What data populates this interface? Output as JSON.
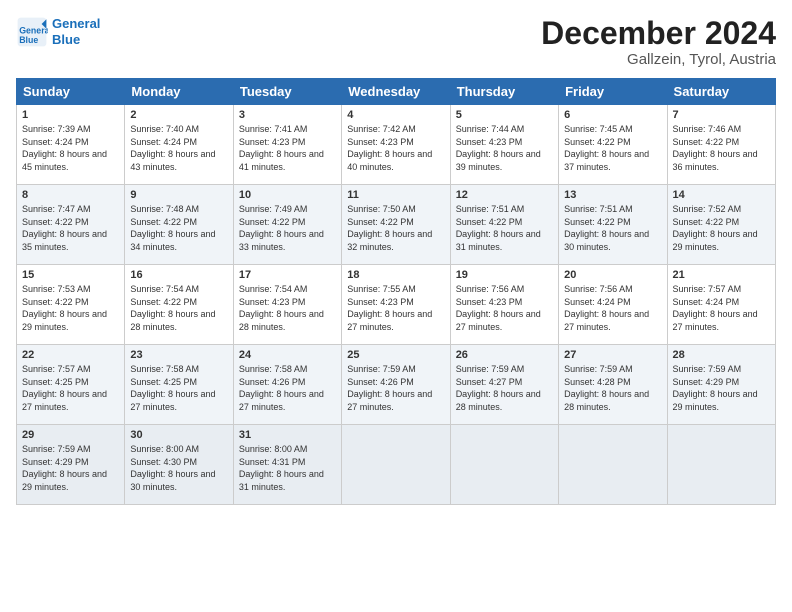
{
  "logo": {
    "line1": "General",
    "line2": "Blue"
  },
  "header": {
    "title": "December 2024",
    "location": "Gallzein, Tyrol, Austria"
  },
  "weekdays": [
    "Sunday",
    "Monday",
    "Tuesday",
    "Wednesday",
    "Thursday",
    "Friday",
    "Saturday"
  ],
  "weeks": [
    [
      {
        "day": "1",
        "sunrise": "Sunrise: 7:39 AM",
        "sunset": "Sunset: 4:24 PM",
        "daylight": "Daylight: 8 hours and 45 minutes."
      },
      {
        "day": "2",
        "sunrise": "Sunrise: 7:40 AM",
        "sunset": "Sunset: 4:24 PM",
        "daylight": "Daylight: 8 hours and 43 minutes."
      },
      {
        "day": "3",
        "sunrise": "Sunrise: 7:41 AM",
        "sunset": "Sunset: 4:23 PM",
        "daylight": "Daylight: 8 hours and 41 minutes."
      },
      {
        "day": "4",
        "sunrise": "Sunrise: 7:42 AM",
        "sunset": "Sunset: 4:23 PM",
        "daylight": "Daylight: 8 hours and 40 minutes."
      },
      {
        "day": "5",
        "sunrise": "Sunrise: 7:44 AM",
        "sunset": "Sunset: 4:23 PM",
        "daylight": "Daylight: 8 hours and 39 minutes."
      },
      {
        "day": "6",
        "sunrise": "Sunrise: 7:45 AM",
        "sunset": "Sunset: 4:22 PM",
        "daylight": "Daylight: 8 hours and 37 minutes."
      },
      {
        "day": "7",
        "sunrise": "Sunrise: 7:46 AM",
        "sunset": "Sunset: 4:22 PM",
        "daylight": "Daylight: 8 hours and 36 minutes."
      }
    ],
    [
      {
        "day": "8",
        "sunrise": "Sunrise: 7:47 AM",
        "sunset": "Sunset: 4:22 PM",
        "daylight": "Daylight: 8 hours and 35 minutes."
      },
      {
        "day": "9",
        "sunrise": "Sunrise: 7:48 AM",
        "sunset": "Sunset: 4:22 PM",
        "daylight": "Daylight: 8 hours and 34 minutes."
      },
      {
        "day": "10",
        "sunrise": "Sunrise: 7:49 AM",
        "sunset": "Sunset: 4:22 PM",
        "daylight": "Daylight: 8 hours and 33 minutes."
      },
      {
        "day": "11",
        "sunrise": "Sunrise: 7:50 AM",
        "sunset": "Sunset: 4:22 PM",
        "daylight": "Daylight: 8 hours and 32 minutes."
      },
      {
        "day": "12",
        "sunrise": "Sunrise: 7:51 AM",
        "sunset": "Sunset: 4:22 PM",
        "daylight": "Daylight: 8 hours and 31 minutes."
      },
      {
        "day": "13",
        "sunrise": "Sunrise: 7:51 AM",
        "sunset": "Sunset: 4:22 PM",
        "daylight": "Daylight: 8 hours and 30 minutes."
      },
      {
        "day": "14",
        "sunrise": "Sunrise: 7:52 AM",
        "sunset": "Sunset: 4:22 PM",
        "daylight": "Daylight: 8 hours and 29 minutes."
      }
    ],
    [
      {
        "day": "15",
        "sunrise": "Sunrise: 7:53 AM",
        "sunset": "Sunset: 4:22 PM",
        "daylight": "Daylight: 8 hours and 29 minutes."
      },
      {
        "day": "16",
        "sunrise": "Sunrise: 7:54 AM",
        "sunset": "Sunset: 4:22 PM",
        "daylight": "Daylight: 8 hours and 28 minutes."
      },
      {
        "day": "17",
        "sunrise": "Sunrise: 7:54 AM",
        "sunset": "Sunset: 4:23 PM",
        "daylight": "Daylight: 8 hours and 28 minutes."
      },
      {
        "day": "18",
        "sunrise": "Sunrise: 7:55 AM",
        "sunset": "Sunset: 4:23 PM",
        "daylight": "Daylight: 8 hours and 27 minutes."
      },
      {
        "day": "19",
        "sunrise": "Sunrise: 7:56 AM",
        "sunset": "Sunset: 4:23 PM",
        "daylight": "Daylight: 8 hours and 27 minutes."
      },
      {
        "day": "20",
        "sunrise": "Sunrise: 7:56 AM",
        "sunset": "Sunset: 4:24 PM",
        "daylight": "Daylight: 8 hours and 27 minutes."
      },
      {
        "day": "21",
        "sunrise": "Sunrise: 7:57 AM",
        "sunset": "Sunset: 4:24 PM",
        "daylight": "Daylight: 8 hours and 27 minutes."
      }
    ],
    [
      {
        "day": "22",
        "sunrise": "Sunrise: 7:57 AM",
        "sunset": "Sunset: 4:25 PM",
        "daylight": "Daylight: 8 hours and 27 minutes."
      },
      {
        "day": "23",
        "sunrise": "Sunrise: 7:58 AM",
        "sunset": "Sunset: 4:25 PM",
        "daylight": "Daylight: 8 hours and 27 minutes."
      },
      {
        "day": "24",
        "sunrise": "Sunrise: 7:58 AM",
        "sunset": "Sunset: 4:26 PM",
        "daylight": "Daylight: 8 hours and 27 minutes."
      },
      {
        "day": "25",
        "sunrise": "Sunrise: 7:59 AM",
        "sunset": "Sunset: 4:26 PM",
        "daylight": "Daylight: 8 hours and 27 minutes."
      },
      {
        "day": "26",
        "sunrise": "Sunrise: 7:59 AM",
        "sunset": "Sunset: 4:27 PM",
        "daylight": "Daylight: 8 hours and 28 minutes."
      },
      {
        "day": "27",
        "sunrise": "Sunrise: 7:59 AM",
        "sunset": "Sunset: 4:28 PM",
        "daylight": "Daylight: 8 hours and 28 minutes."
      },
      {
        "day": "28",
        "sunrise": "Sunrise: 7:59 AM",
        "sunset": "Sunset: 4:29 PM",
        "daylight": "Daylight: 8 hours and 29 minutes."
      }
    ],
    [
      {
        "day": "29",
        "sunrise": "Sunrise: 7:59 AM",
        "sunset": "Sunset: 4:29 PM",
        "daylight": "Daylight: 8 hours and 29 minutes."
      },
      {
        "day": "30",
        "sunrise": "Sunrise: 8:00 AM",
        "sunset": "Sunset: 4:30 PM",
        "daylight": "Daylight: 8 hours and 30 minutes."
      },
      {
        "day": "31",
        "sunrise": "Sunrise: 8:00 AM",
        "sunset": "Sunset: 4:31 PM",
        "daylight": "Daylight: 8 hours and 31 minutes."
      },
      null,
      null,
      null,
      null
    ]
  ]
}
